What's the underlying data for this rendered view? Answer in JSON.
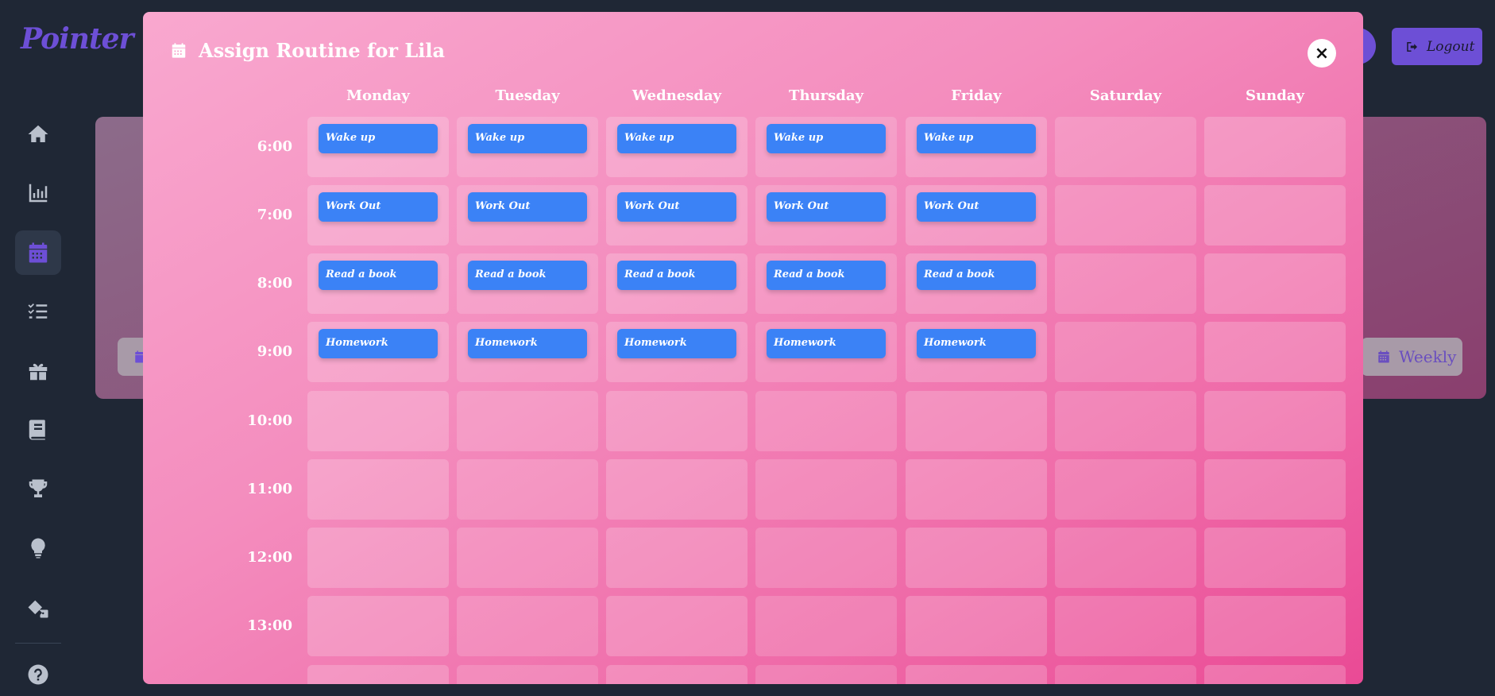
{
  "app": {
    "logo": "Pointer"
  },
  "sidebar": {
    "items": [
      {
        "icon": "home-icon"
      },
      {
        "icon": "chart-icon"
      },
      {
        "icon": "calendar-icon",
        "active": true
      },
      {
        "icon": "tasks-icon"
      },
      {
        "icon": "gift-icon"
      },
      {
        "icon": "book-icon"
      },
      {
        "icon": "trophy-icon"
      },
      {
        "icon": "lightbulb-icon"
      },
      {
        "icon": "dice-icon"
      },
      {
        "icon": "help-icon"
      }
    ]
  },
  "header": {
    "logout_label": "Logout"
  },
  "background": {
    "weekly_label": "Weekly"
  },
  "modal": {
    "title": "Assign Routine for Lila",
    "close_label": "×",
    "days": [
      "Monday",
      "Tuesday",
      "Wednesday",
      "Thursday",
      "Friday",
      "Saturday",
      "Sunday"
    ],
    "times": [
      "6:00",
      "7:00",
      "8:00",
      "9:00",
      "10:00",
      "11:00",
      "12:00",
      "13:00",
      ""
    ],
    "schedule": {
      "6:00": [
        "Wake up",
        "Wake up",
        "Wake up",
        "Wake up",
        "Wake up",
        "",
        ""
      ],
      "7:00": [
        "Work Out",
        "Work Out",
        "Work Out",
        "Work Out",
        "Work Out",
        "",
        ""
      ],
      "8:00": [
        "Read a book",
        "Read a book",
        "Read a book",
        "Read a book",
        "Read a book",
        "",
        ""
      ],
      "9:00": [
        "Homework",
        "Homework",
        "Homework",
        "Homework",
        "Homework",
        "",
        ""
      ]
    }
  },
  "colors": {
    "accent": "#6d4fd6",
    "task": "#3b82f6",
    "modal_bg": "#f48dbe",
    "app_bg": "#1f2735"
  }
}
